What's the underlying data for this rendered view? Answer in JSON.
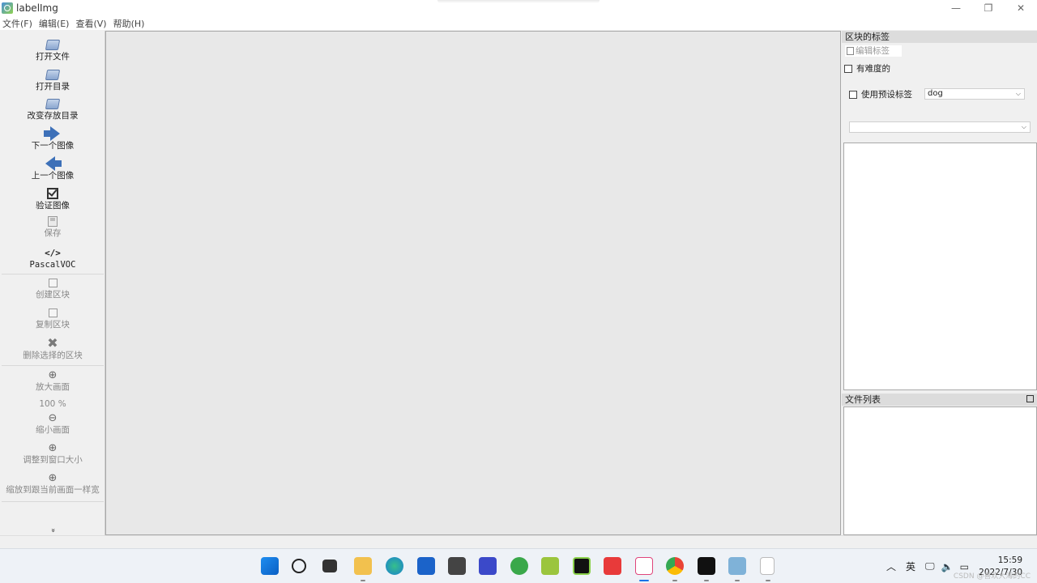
{
  "window": {
    "title": "labelImg",
    "min_glyph": "—",
    "restore_glyph": "❐",
    "close_glyph": "✕"
  },
  "menu": [
    "文件(F)",
    "编辑(E)",
    "查看(V)",
    "帮助(H)"
  ],
  "toolbar": {
    "open_file": "打开文件",
    "open_dir": "打开目录",
    "change_save_dir": "改变存放目录",
    "next_image": "下一个图像",
    "prev_image": "上一个图像",
    "verify_image": "验证图像",
    "save": "保存",
    "format_glyph": "</>",
    "format": "PascalVOC",
    "create_box": "创建区块",
    "duplicate_box": "复制区块",
    "delete_box": "删除选择的区块",
    "zoom_in": "放大画面",
    "zoom_level": "100 %",
    "zoom_out": "缩小画面",
    "fit_window": "调整到窗口大小",
    "fit_width": "缩放到跟当前画面一样宽",
    "more_glyph": "»"
  },
  "dock": {
    "box_labels_title": "区块的标签",
    "edit_label": "编辑标签",
    "difficult": "有难度的",
    "use_default_label": "使用预设标签",
    "default_label_value": "dog",
    "label_filter_value": "",
    "file_list_title": "文件列表"
  },
  "taskbar": {
    "ime": "英",
    "time": "15:59",
    "date": "2022/7/30",
    "watermark": "CSDN @喜欢大海的CC"
  },
  "icons": [
    "folder-icon",
    "next-arrow-icon",
    "prev-arrow-icon",
    "verify-check-icon",
    "save-icon",
    "code-icon",
    "create-box-icon",
    "duplicate-icon",
    "delete-icon",
    "zoom-in-icon",
    "zoom-out-icon",
    "fit-window-icon",
    "fit-width-icon"
  ]
}
